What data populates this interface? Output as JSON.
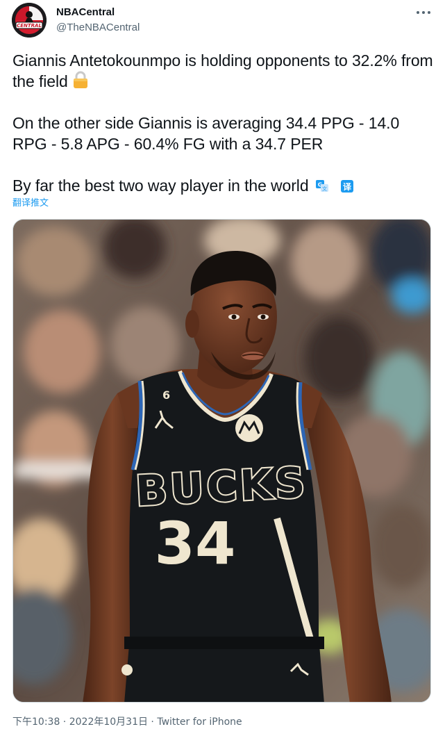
{
  "author": {
    "display_name": "NBACentral",
    "handle": "@TheNBACentral",
    "avatar_text": "CENTRAL"
  },
  "tweet": {
    "line1": "Giannis Antetokounmpo is holding opponents to 32.2% from the field",
    "line2": "On the other side Giannis is averaging 34.4 PPG - 14.0 RPG - 5.8 APG - 60.4% FG with a 34.7 PER",
    "line3": "By far the best two way player in the world",
    "translate_label": "翻译推文"
  },
  "media": {
    "jersey_text": "BUCKS",
    "jersey_number": "34",
    "collar_number": "6"
  },
  "meta": {
    "time": "下午10:38",
    "separator1": " · ",
    "date": "2022年10月31日",
    "separator2": " · ",
    "source": "Twitter for iPhone"
  },
  "icons": {
    "emoji": "lock-icon",
    "more": "more-dots-icon",
    "translate": "translate-icon"
  },
  "colors": {
    "link": "#1d9bf0",
    "secondary_text": "#536471",
    "primary_text": "#0f1419",
    "jersey": "#15181b",
    "jersey_trim_cream": "#efe6cf",
    "jersey_trim_blue": "#2d66b6"
  }
}
